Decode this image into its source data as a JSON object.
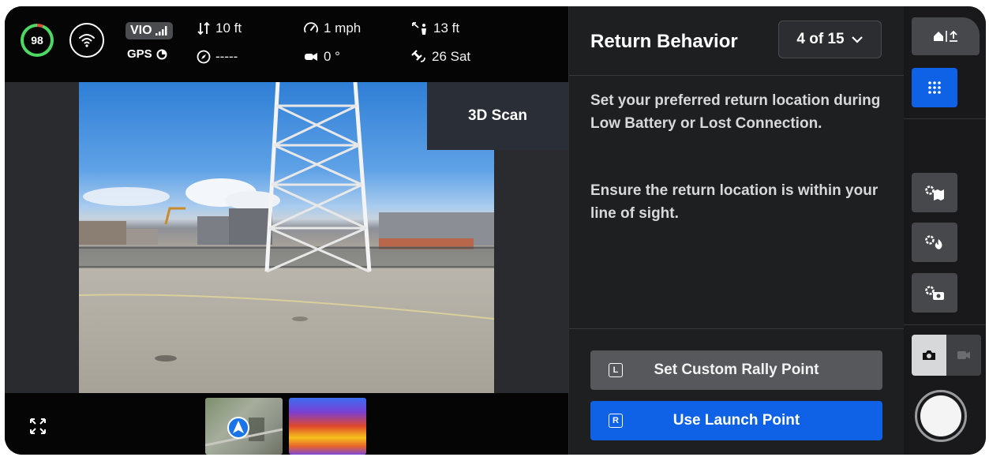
{
  "telemetry": {
    "battery": "98",
    "vio_label": "VIO",
    "gps_label": "GPS",
    "vertical": "10 ft",
    "heading": "-----",
    "speed": "1 mph",
    "gimbal": "0 °",
    "distance": "13 ft",
    "satellites": "26 Sat"
  },
  "viewport": {
    "mode_label": "3D Scan"
  },
  "panel": {
    "title": "Return Behavior",
    "pager": "4 of 15",
    "description_1": "Set your preferred return location during Low Battery or Lost Connection.",
    "description_2": "Ensure the return location is within your line of sight.",
    "custom_rally": {
      "key": "L",
      "label": "Set Custom Rally Point"
    },
    "launch_point": {
      "key": "R",
      "label": "Use Launch Point"
    }
  },
  "colors": {
    "accent": "#0f62e6",
    "battery_good": "#4cd964",
    "battery_low": "#e04a3a"
  }
}
